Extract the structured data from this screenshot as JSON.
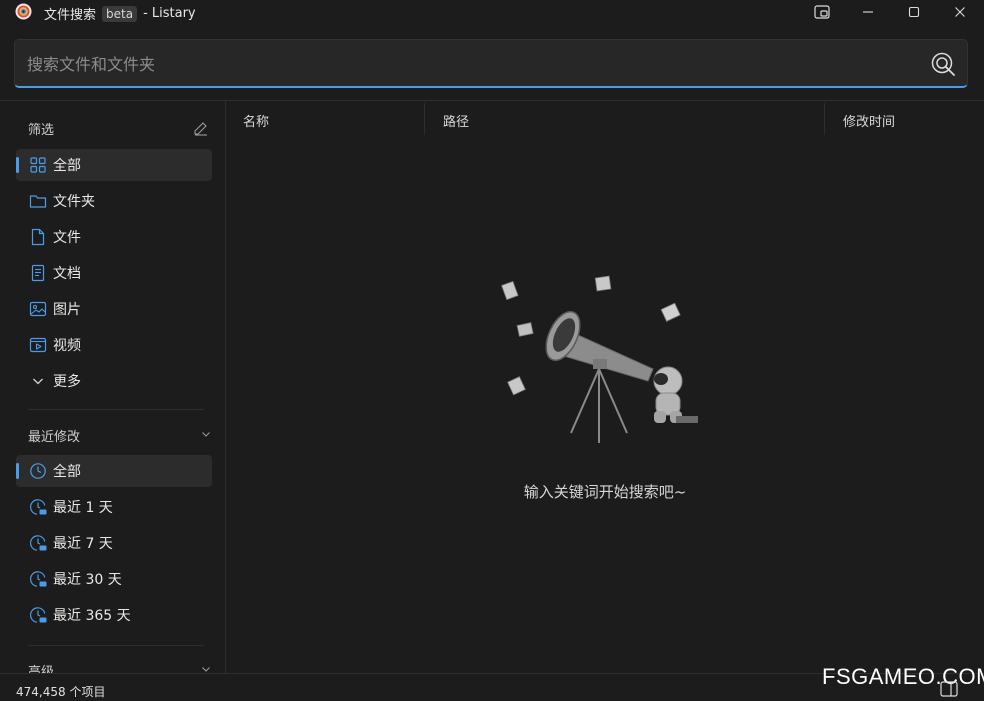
{
  "window": {
    "title": "文件搜索",
    "badge": "beta",
    "app_name": "- Listary"
  },
  "search": {
    "placeholder": "搜索文件和文件夹",
    "value": ""
  },
  "filters": {
    "title": "筛选",
    "items": [
      {
        "label": "全部",
        "icon": "grid-icon",
        "active": true
      },
      {
        "label": "文件夹",
        "icon": "folder-icon"
      },
      {
        "label": "文件",
        "icon": "file-icon"
      },
      {
        "label": "文档",
        "icon": "document-icon"
      },
      {
        "label": "图片",
        "icon": "image-icon"
      },
      {
        "label": "视频",
        "icon": "video-icon"
      },
      {
        "label": "更多",
        "icon": "chevron-down-icon"
      }
    ]
  },
  "recent": {
    "title": "最近修改",
    "items": [
      {
        "label": "全部",
        "icon": "clock-icon",
        "active": true
      },
      {
        "label": "最近 1 天",
        "icon": "clock-1d-icon"
      },
      {
        "label": "最近 7 天",
        "icon": "clock-7d-icon"
      },
      {
        "label": "最近 30 天",
        "icon": "clock-1m-icon"
      },
      {
        "label": "最近 365 天",
        "icon": "clock-1y-icon"
      }
    ]
  },
  "advanced": {
    "title": "高级"
  },
  "columns": {
    "name": "名称",
    "path": "路径",
    "modified": "修改时间"
  },
  "empty_state": {
    "message": "输入关键词开始搜索吧~"
  },
  "status": {
    "count": "474,458 个项目"
  },
  "watermark": "FSGAMEO.COM",
  "colors": {
    "accent": "#4c9be8",
    "background": "#1c1c1c"
  }
}
